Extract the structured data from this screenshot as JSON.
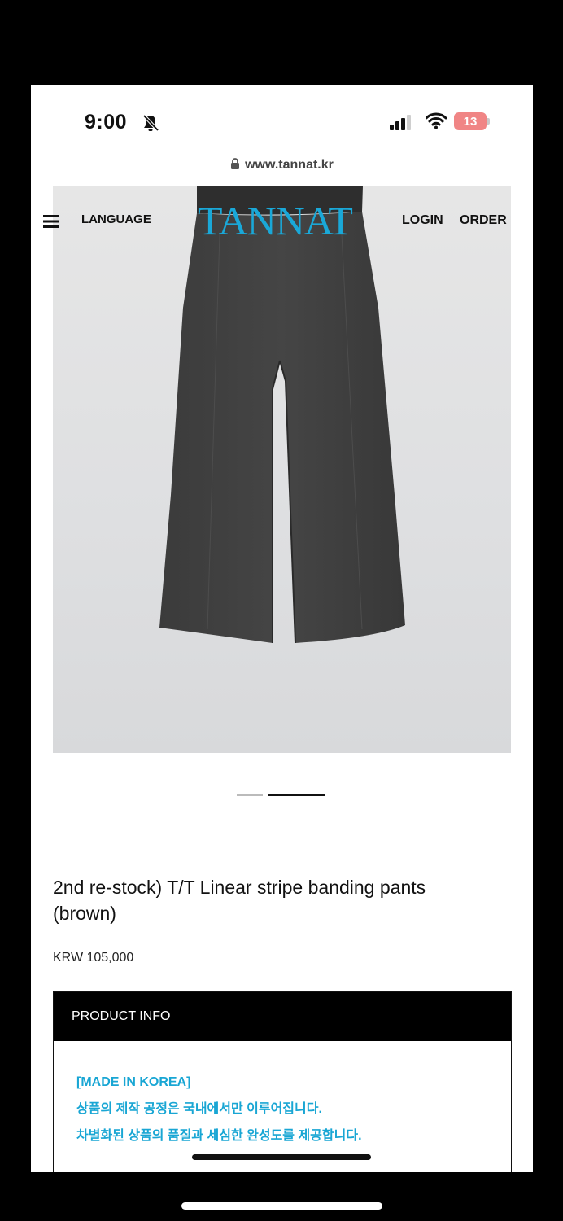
{
  "status_bar": {
    "time": "9:00",
    "battery": "13"
  },
  "browser": {
    "url": "www.tannat.kr"
  },
  "header": {
    "language": "LANGUAGE",
    "logo": "TANNAT",
    "login": "LOGIN",
    "order": "ORDER"
  },
  "product": {
    "title": "2nd re-stock) T/T Linear stripe banding pants (brown)",
    "price": "KRW 105,000",
    "slider": {
      "total": 2,
      "active": 2
    }
  },
  "info": {
    "heading": "PRODUCT INFO",
    "lines": [
      "[MADE IN KOREA]",
      "상품의 제작 공정은 국내에서만 이루어집니다.",
      "차별화된 상품의 품질과 세심한 완성도를 제공합니다."
    ]
  },
  "colors": {
    "accent": "#1aa8d8",
    "info_header_bg": "#000000"
  },
  "icons": [
    "bell-slash-icon",
    "signal-icon",
    "wifi-icon",
    "battery-icon",
    "lock-icon",
    "hamburger-menu-icon"
  ]
}
